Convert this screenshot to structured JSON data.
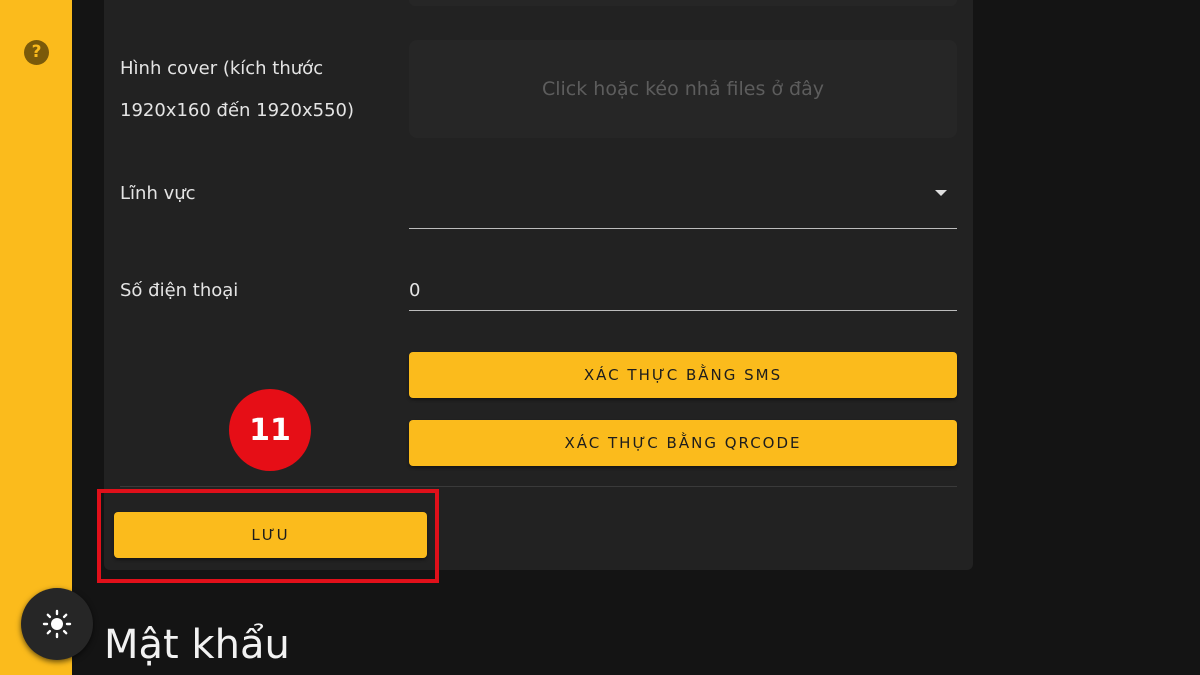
{
  "sidebar": {
    "help_icon_glyph": "?",
    "accent_color": "#fbbb1c"
  },
  "form": {
    "cover_label": "Hình cover (kích thước 1920x160 đến 1920x550)",
    "dropzone_text": "Click hoặc kéo nhả files ở đây",
    "field_label": "Lĩnh vực",
    "phone_label": "Số điện thoại",
    "phone_value": "0",
    "sms_button": "XÁC THỰC BẰNG SMS",
    "qrcode_button": "XÁC THỰC BẰNG QRCODE",
    "save_button": "LƯU"
  },
  "annotation": {
    "step_number": "11",
    "highlight_color": "#e0101a"
  },
  "section": {
    "heading": "Mật khẩu"
  }
}
